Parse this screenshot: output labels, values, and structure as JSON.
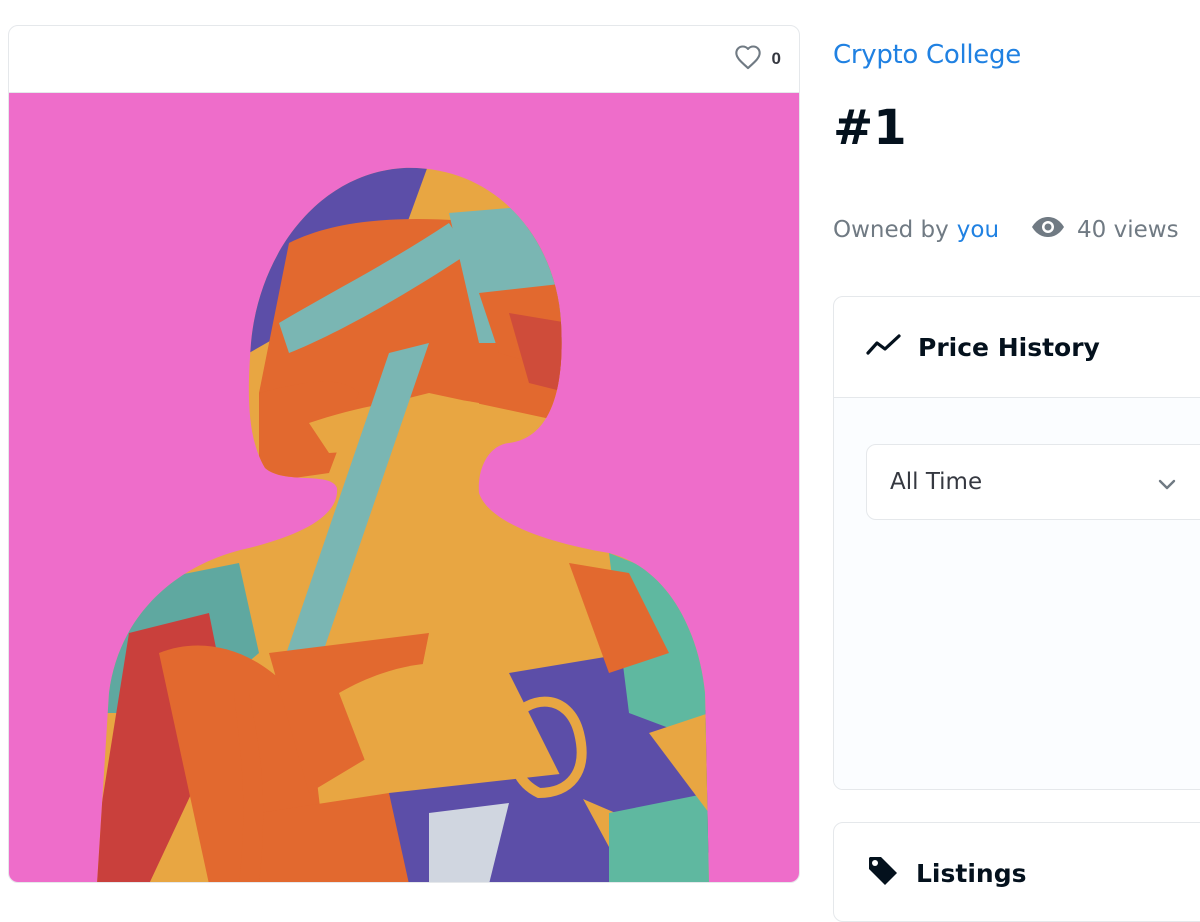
{
  "favorites": {
    "count": "0"
  },
  "collection": {
    "name": "Crypto College"
  },
  "asset": {
    "title": "#1"
  },
  "owner": {
    "prefix": "Owned by",
    "name": "you"
  },
  "views": {
    "label": "40 views"
  },
  "price_history": {
    "title": "Price History",
    "filter": {
      "selected": "All Time"
    }
  },
  "listings": {
    "title": "Listings"
  },
  "colors": {
    "accent": "#2081e2",
    "art_background": "#ee6dca",
    "text_primary": "#04111d",
    "text_secondary": "#707a83"
  },
  "icons": {
    "favorite": "heart-icon",
    "views": "eye-icon",
    "price_history": "trending-line-icon",
    "dropdown": "chevron-down-icon",
    "listings": "tag-icon"
  }
}
